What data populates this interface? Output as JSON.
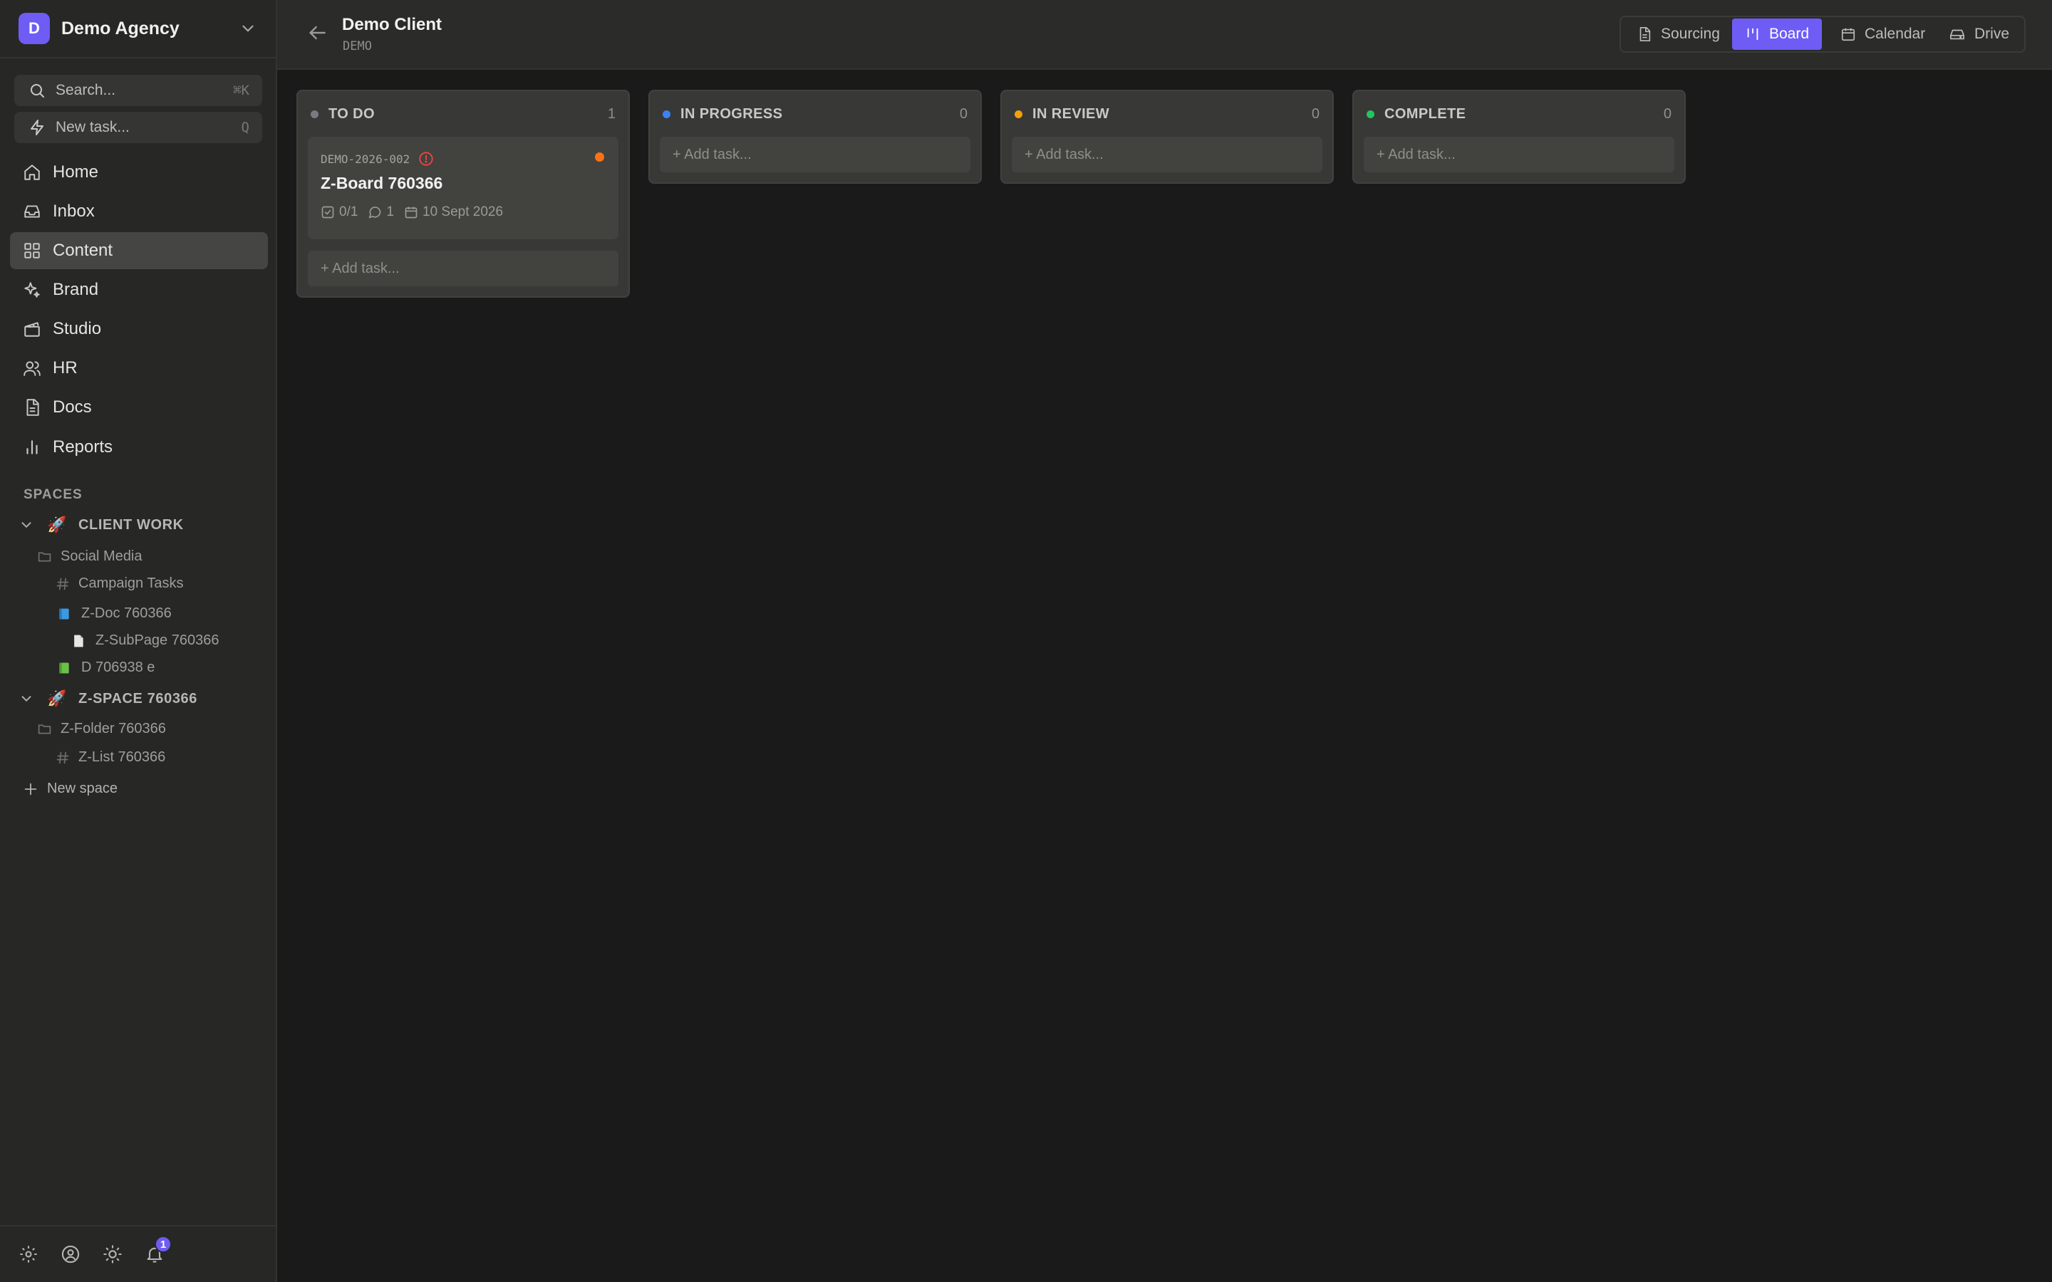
{
  "workspace": {
    "initial": "D",
    "name": "Demo Agency"
  },
  "sidebar": {
    "search": {
      "label": "Search...",
      "shortcut": "⌘K"
    },
    "new_task": {
      "label": "New task...",
      "shortcut": "Q"
    },
    "nav": [
      {
        "label": "Home",
        "icon": "home-icon"
      },
      {
        "label": "Inbox",
        "icon": "inbox-icon"
      },
      {
        "label": "Content",
        "icon": "grid-icon",
        "active": true
      },
      {
        "label": "Brand",
        "icon": "sparkle-icon"
      },
      {
        "label": "Studio",
        "icon": "clapperboard-icon"
      },
      {
        "label": "HR",
        "icon": "users-icon"
      },
      {
        "label": "Docs",
        "icon": "document-icon"
      },
      {
        "label": "Reports",
        "icon": "bar-chart-icon"
      }
    ],
    "spaces_title": "SPACES",
    "spaces": [
      {
        "emoji": "🚀",
        "name": "CLIENT WORK",
        "folder": "Social Media",
        "items": [
          {
            "label": "Campaign Tasks",
            "icon": "hash-icon"
          },
          {
            "label": "Z-Doc 760366",
            "icon": "blue-book-icon"
          },
          {
            "label": "Z-SubPage 760366",
            "icon": "page-icon"
          },
          {
            "label": "D 706938 e",
            "icon": "green-book-icon"
          }
        ]
      },
      {
        "emoji": "🚀",
        "name": "Z-SPACE 760366",
        "folder": "Z-Folder 760366",
        "items": [
          {
            "label": "Z-List 760366",
            "icon": "hash-icon"
          }
        ]
      }
    ],
    "new_space": "New space",
    "notifications_count": "1"
  },
  "header": {
    "title": "Demo Client",
    "code": "DEMO",
    "views": [
      {
        "label": "Sourcing",
        "icon": "document-icon"
      },
      {
        "label": "Board",
        "icon": "board-icon",
        "active": true
      },
      {
        "label": "Calendar",
        "icon": "calendar-icon"
      },
      {
        "label": "Drive",
        "icon": "drive-icon"
      }
    ]
  },
  "board": {
    "add_task_label": "+ Add task...",
    "columns": [
      {
        "title": "TO DO",
        "count": "1",
        "color": "#7a7a86",
        "tasks": [
          {
            "id": "DEMO-2026-002",
            "title": "Z-Board 760366",
            "checklist": "0/1",
            "comments": "1",
            "due": "10 Sept 2026",
            "priority_color": "#f97316"
          }
        ]
      },
      {
        "title": "IN PROGRESS",
        "count": "0",
        "color": "#3b82f6",
        "tasks": []
      },
      {
        "title": "IN REVIEW",
        "count": "0",
        "color": "#f59e0b",
        "tasks": []
      },
      {
        "title": "COMPLETE",
        "count": "0",
        "color": "#22c55e",
        "tasks": []
      }
    ]
  }
}
